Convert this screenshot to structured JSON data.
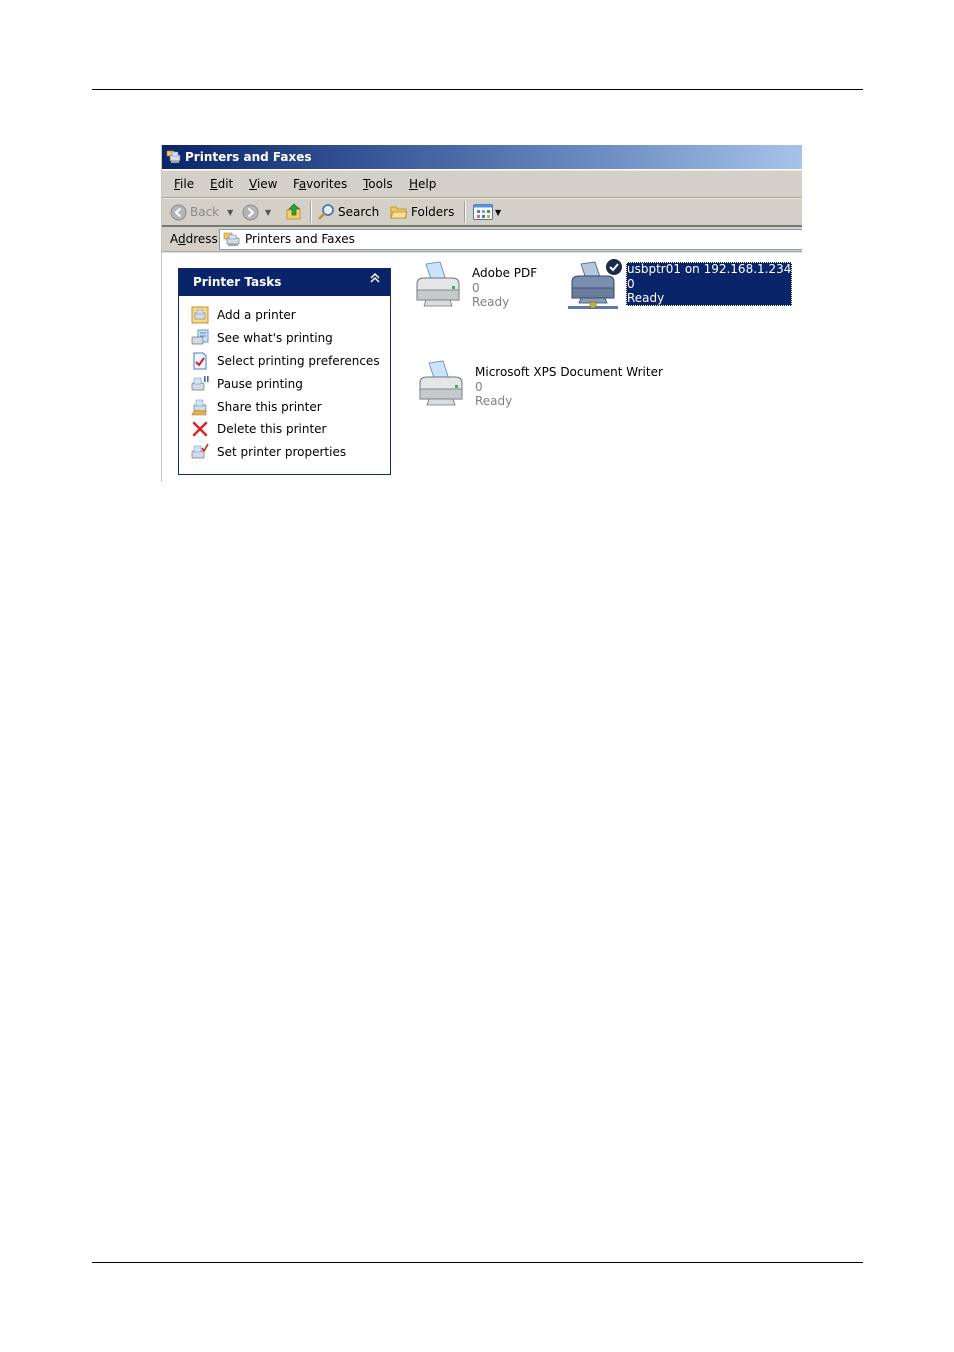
{
  "window": {
    "title": "Printers and Faxes",
    "title_icon": "printers-folder-icon"
  },
  "menu": {
    "items": [
      {
        "label": "File",
        "accel": "F",
        "rest": "ile"
      },
      {
        "label": "Edit",
        "accel": "E",
        "rest": "dit"
      },
      {
        "label": "View",
        "accel": "V",
        "rest": "iew"
      },
      {
        "label": "Favorites",
        "pre": "F",
        "accel": "a",
        "rest": "vorites"
      },
      {
        "label": "Tools",
        "accel": "T",
        "rest": "ools"
      },
      {
        "label": "Help",
        "accel": "H",
        "rest": "elp"
      }
    ]
  },
  "toolbar": {
    "back_label": "Back",
    "search_label": "Search",
    "folders_label": "Folders",
    "icons": [
      "back-arrow-icon",
      "forward-arrow-icon",
      "up-folder-icon",
      "search-magnifier-icon",
      "folders-icon",
      "views-icon"
    ]
  },
  "address": {
    "label_pre": "A",
    "label_accel": "d",
    "label_rest": "dress",
    "value": "Printers and Faxes"
  },
  "tasks": {
    "title": "Printer Tasks",
    "collapse_glyph": "⌃",
    "items": [
      {
        "label": "Add a printer",
        "icon": "add-printer-icon"
      },
      {
        "label": "See what's printing",
        "icon": "print-queue-icon"
      },
      {
        "label": "Select printing preferences",
        "icon": "preferences-check-icon"
      },
      {
        "label": "Pause printing",
        "icon": "pause-printer-icon"
      },
      {
        "label": "Share this printer",
        "icon": "share-printer-icon"
      },
      {
        "label": "Delete this printer",
        "icon": "delete-x-icon"
      },
      {
        "label": "Set printer properties",
        "icon": "printer-properties-icon"
      }
    ]
  },
  "printers": [
    {
      "name": "Adobe PDF",
      "jobs": "0",
      "status": "Ready",
      "selected": false,
      "default": false,
      "network": false
    },
    {
      "name": "usbptr01 on 192.168.1.234",
      "jobs": "0",
      "status": "Ready",
      "selected": true,
      "default": true,
      "network": true
    },
    {
      "name": "Microsoft XPS Document Writer",
      "jobs": "0",
      "status": "Ready",
      "selected": false,
      "default": false,
      "network": false
    }
  ],
  "colors": {
    "titlebar_start": "#0a246a",
    "titlebar_end": "#a6c3ea",
    "chrome": "#d4d0c8",
    "selection": "#0a246a",
    "task_header": "#0a246a"
  }
}
